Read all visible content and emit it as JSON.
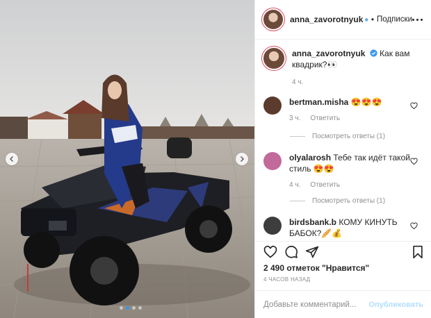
{
  "post": {
    "author": "anna_zavorotnyuk",
    "follow_label": "Подписки",
    "separator": "•",
    "caption_text": "Как вам квадрик?👀",
    "caption_time": "4 ч.",
    "likes_text": "2 490 отметок \"Нравится\"",
    "time_ago": "4 ЧАСОВ НАЗАД",
    "carousel": {
      "slides": 4,
      "active": 1
    }
  },
  "comments": [
    {
      "user": "bertman.misha",
      "text": "😍😍😍",
      "time": "3 ч.",
      "reply_label": "Ответить",
      "replies_label": "Посмотреть ответы (1)",
      "avatar_color": "#5b3b2d"
    },
    {
      "user": "olyalarosh",
      "text": "Тебе так идёт такой стиль 😍😍",
      "time": "4 ч.",
      "reply_label": "Ответить",
      "replies_label": "Посмотреть ответы (1)",
      "avatar_color": "#c26a9a"
    },
    {
      "user": "birdsbank.b",
      "text": "КОМУ КИНУТЬ БАБОК?🥖💰",
      "avatar_color": "#3d3d3d"
    }
  ],
  "composer": {
    "placeholder": "Добавьте комментарий...",
    "publish_label": "Опубликовать"
  },
  "colors": {
    "accent": "#3897f0",
    "publish_disabled": "#b2dffc",
    "muted": "#8e8e8e",
    "story_ring": "#e0455e"
  },
  "icons": {
    "like": "heart-icon",
    "comment": "comment-icon",
    "share": "paper-plane-icon",
    "save": "bookmark-icon",
    "more": "more-dots-icon",
    "verified": "verified-badge-icon"
  }
}
